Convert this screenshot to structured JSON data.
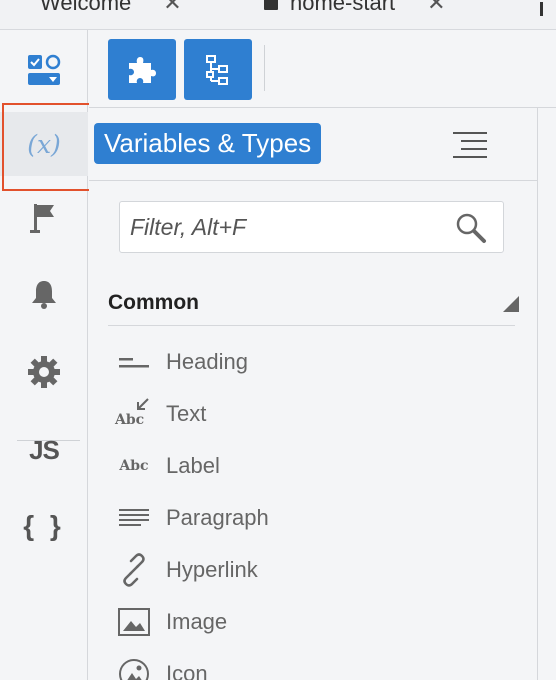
{
  "tabs": [
    {
      "label": "Welcome",
      "close": "✕"
    },
    {
      "label": "home-start",
      "close": "✕"
    }
  ],
  "activity_bar": {
    "items": [
      {
        "name": "components-icon",
        "selected": false
      },
      {
        "name": "variables-icon",
        "label": "(x)",
        "selected": true
      },
      {
        "name": "flag-icon",
        "selected": false
      },
      {
        "name": "bell-icon",
        "selected": false
      },
      {
        "name": "gear-icon",
        "selected": false
      },
      {
        "name": "js-icon",
        "label": "JS",
        "selected": false
      },
      {
        "name": "braces-icon",
        "label": "{ }",
        "selected": false
      }
    ],
    "highlight_color": "#e2512c"
  },
  "toolbar": {
    "buttons": [
      {
        "name": "puzzle-icon"
      },
      {
        "name": "tree-structure-icon"
      }
    ]
  },
  "panel": {
    "title": "Variables & Types",
    "filter_placeholder": "Filter, Alt+F",
    "section_title": "Common",
    "items": [
      {
        "label": "Heading",
        "icon": "heading-icon"
      },
      {
        "label": "Text",
        "icon": "text-abc-icon",
        "icon_text": "Abc"
      },
      {
        "label": "Label",
        "icon": "label-abc-icon",
        "icon_text": "Abc"
      },
      {
        "label": "Paragraph",
        "icon": "paragraph-icon"
      },
      {
        "label": "Hyperlink",
        "icon": "link-icon"
      },
      {
        "label": "Image",
        "icon": "image-icon"
      },
      {
        "label": "Icon",
        "icon": "icon-icon"
      }
    ]
  },
  "colors": {
    "accent": "#2f7fd1",
    "highlight": "#e2512c",
    "variables_icon": "#7aa7d6"
  }
}
